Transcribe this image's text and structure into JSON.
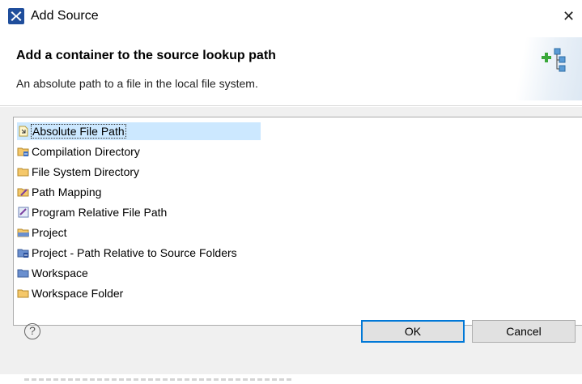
{
  "window": {
    "title": "Add Source",
    "close_glyph": "✕"
  },
  "header": {
    "title": "Add a container to the source lookup path",
    "description": "An absolute path to a file in the local file system.",
    "icon": "add-source-container-icon"
  },
  "list": {
    "selected_index": 0,
    "items": [
      {
        "label": "Absolute File Path",
        "icon": "absolute-file-path-icon"
      },
      {
        "label": "Compilation Directory",
        "icon": "compilation-directory-icon"
      },
      {
        "label": "File System Directory",
        "icon": "folder-icon"
      },
      {
        "label": "Path Mapping",
        "icon": "path-mapping-icon"
      },
      {
        "label": "Program Relative File Path",
        "icon": "program-relative-path-icon"
      },
      {
        "label": "Project",
        "icon": "project-icon"
      },
      {
        "label": "Project - Path Relative to Source Folders",
        "icon": "project-relative-icon"
      },
      {
        "label": "Workspace",
        "icon": "workspace-icon"
      },
      {
        "label": "Workspace Folder",
        "icon": "folder-icon"
      }
    ]
  },
  "footer": {
    "help_glyph": "?",
    "ok_label": "OK",
    "cancel_label": "Cancel"
  },
  "colors": {
    "selection": "#cce8ff",
    "default_button_border": "#0078d7",
    "body_bg": "#f0f0f0"
  }
}
